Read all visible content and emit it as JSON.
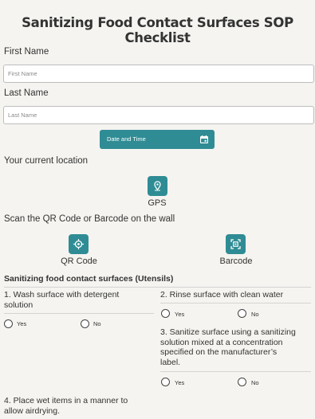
{
  "title": "Sanitizing Food Contact Surfaces SOP Checklist",
  "first_name": {
    "label": "First Name",
    "placeholder": "First Name"
  },
  "last_name": {
    "label": "Last Name",
    "placeholder": "Last Name"
  },
  "datetime": {
    "label": "Date and Time",
    "icon": "calendar-icon"
  },
  "location": {
    "label": "Your current location",
    "gps_label": "GPS",
    "icon": "location-pin-icon"
  },
  "scan": {
    "label": "Scan the QR Code or Barcode on the wall",
    "qr_label": "QR Code",
    "barcode_label": "Barcode"
  },
  "section": {
    "title": "Sanitizing food contact surfaces (Utensils)"
  },
  "questions": [
    {
      "text_line1": "1. Wash surface with detergent",
      "text_line2": "solution",
      "yes": "Yes",
      "no": "No"
    },
    {
      "text_line1": "2. Rinse surface with clean water",
      "yes": "Yes",
      "no": "No"
    },
    {
      "text_line1": "3. Sanitize surface using a sanitizing",
      "text_line2": "solution mixed at a concentration",
      "text_line3": "specified on the manufacturer’s",
      "text_line4": "label.",
      "yes": "Yes",
      "no": "No"
    },
    {
      "text_line1": "4. Place wet items in a manner to",
      "text_line2": "allow airdrying."
    }
  ],
  "colors": {
    "accent": "#2f8c94",
    "background": "#f5f4f0"
  }
}
